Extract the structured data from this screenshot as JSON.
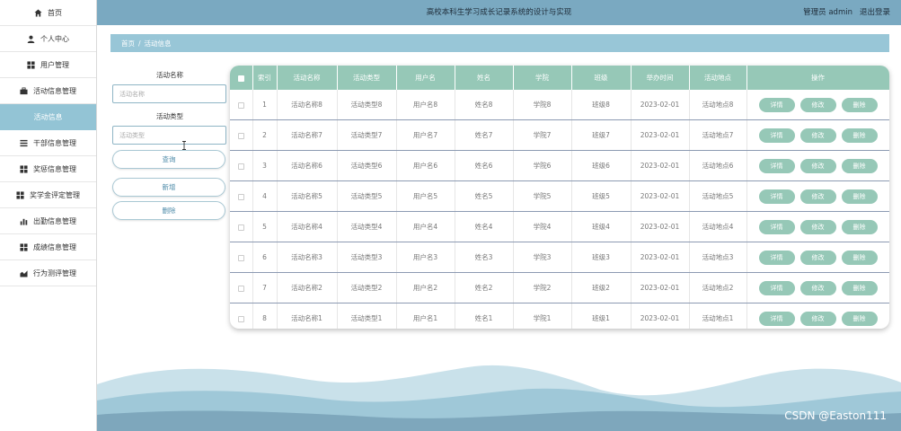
{
  "header": {
    "title": "高校本科生学习成长记录系统的设计与实现",
    "user": "管理员 admin",
    "logout": "退出登录"
  },
  "sidebar": {
    "items": [
      {
        "label": "首页",
        "icon": "home-icon"
      },
      {
        "label": "个人中心",
        "icon": "user-icon"
      },
      {
        "label": "用户管理",
        "icon": "grid-icon"
      },
      {
        "label": "活动信息管理",
        "icon": "briefcase-icon"
      },
      {
        "label": "活动信息",
        "icon": "",
        "active": true
      },
      {
        "label": "干部信息管理",
        "icon": "list-icon"
      },
      {
        "label": "奖惩信息管理",
        "icon": "grid-icon"
      },
      {
        "label": "奖学金评定管理",
        "icon": "grid-icon"
      },
      {
        "label": "出勤信息管理",
        "icon": "bar-chart-icon"
      },
      {
        "label": "成绩信息管理",
        "icon": "grid-icon"
      },
      {
        "label": "行为测评管理",
        "icon": "chart-icon"
      }
    ]
  },
  "breadcrumb": {
    "home": "首页",
    "separator": "/",
    "current": "活动信息"
  },
  "search": {
    "name_label": "活动名称",
    "name_placeholder": "活动名称",
    "type_label": "活动类型",
    "type_placeholder": "活动类型",
    "search_button": "查询",
    "add_button": "新增",
    "delete_button": "删除"
  },
  "table": {
    "headers": [
      "",
      "索引",
      "活动名称",
      "活动类型",
      "用户名",
      "姓名",
      "学院",
      "班级",
      "举办时间",
      "活动地点",
      "操作"
    ],
    "rows": [
      [
        "1",
        "活动名称8",
        "活动类型8",
        "用户名8",
        "姓名8",
        "学院8",
        "班级8",
        "2023-02-01",
        "活动地点8"
      ],
      [
        "2",
        "活动名称7",
        "活动类型7",
        "用户名7",
        "姓名7",
        "学院7",
        "班级7",
        "2023-02-01",
        "活动地点7"
      ],
      [
        "3",
        "活动名称6",
        "活动类型6",
        "用户名6",
        "姓名6",
        "学院6",
        "班级6",
        "2023-02-01",
        "活动地点6"
      ],
      [
        "4",
        "活动名称5",
        "活动类型5",
        "用户名5",
        "姓名5",
        "学院5",
        "班级5",
        "2023-02-01",
        "活动地点5"
      ],
      [
        "5",
        "活动名称4",
        "活动类型4",
        "用户名4",
        "姓名4",
        "学院4",
        "班级4",
        "2023-02-01",
        "活动地点4"
      ],
      [
        "6",
        "活动名称3",
        "活动类型3",
        "用户名3",
        "姓名3",
        "学院3",
        "班级3",
        "2023-02-01",
        "活动地点3"
      ],
      [
        "7",
        "活动名称2",
        "活动类型2",
        "用户名2",
        "姓名2",
        "学院2",
        "班级2",
        "2023-02-01",
        "活动地点2"
      ],
      [
        "8",
        "活动名称1",
        "活动类型1",
        "用户名1",
        "姓名1",
        "学院1",
        "班级1",
        "2023-02-01",
        "活动地点1"
      ]
    ],
    "actions": [
      "详情",
      "修改",
      "删除"
    ]
  },
  "watermark": "CSDN @Easton111",
  "colors": {
    "header_bg": "#7aa9c1",
    "accent": "#96c8b7",
    "active_nav": "#93c4d5",
    "breadcrumb_bg": "#98c6d7"
  }
}
